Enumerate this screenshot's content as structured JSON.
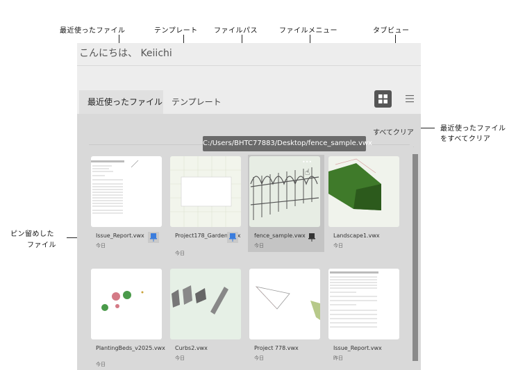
{
  "callouts": {
    "recent_files": "最近使ったファイル",
    "templates": "テンプレート",
    "file_path": "ファイルパス",
    "file_menu": "ファイルメニュー",
    "tab_view": "タブビュー",
    "clear_recent_line1": "最近使ったファイル",
    "clear_recent_line2": "をすべてクリア",
    "pinned_line1": "ピン留めした",
    "pinned_line2": "ファイル"
  },
  "greeting": "こんにちは、 Keiichi",
  "tabs": [
    {
      "label": "最近使ったファイル",
      "active": true
    },
    {
      "label": "テンプレート",
      "active": false
    }
  ],
  "clear_all_label": "すべてクリア",
  "path_tooltip": "C:/Users/BHTC77883/Desktop/fence_sample.vwx",
  "files": [
    {
      "name": "Issue_Report.vwx",
      "date": "今日",
      "pinned": true,
      "thumb": "report"
    },
    {
      "name": "Project178_Garden.vwx",
      "date": "今日",
      "pinned": true,
      "thumb": "garden"
    },
    {
      "name": "fence_sample.vwx",
      "date": "今日",
      "pinned": true,
      "selected": true,
      "thumb": "fence"
    },
    {
      "name": "Landscape1.vwx",
      "date": "今日",
      "pinned": false,
      "thumb": "hedge"
    },
    {
      "name": "PlantingBeds_v2025.vwx",
      "date": "今日",
      "pinned": false,
      "thumb": "plants"
    },
    {
      "name": "Curbs2.vwx",
      "date": "今日",
      "pinned": false,
      "thumb": "curbs"
    },
    {
      "name": "Project 778.vwx",
      "date": "今日",
      "pinned": false,
      "thumb": "triangle"
    },
    {
      "name": "Issue_Report.vwx",
      "date": "昨日",
      "pinned": false,
      "thumb": "report"
    }
  ],
  "file_menu_dots": "•••",
  "colors": {
    "pin": "#3b7ddd",
    "tooltip": "#6a6a6a",
    "grid_button": "#555555"
  },
  "icons": {
    "grid_view": "grid-view-icon",
    "list_view": "list-view-icon",
    "pin": "pin-icon",
    "more": "more-icon"
  }
}
